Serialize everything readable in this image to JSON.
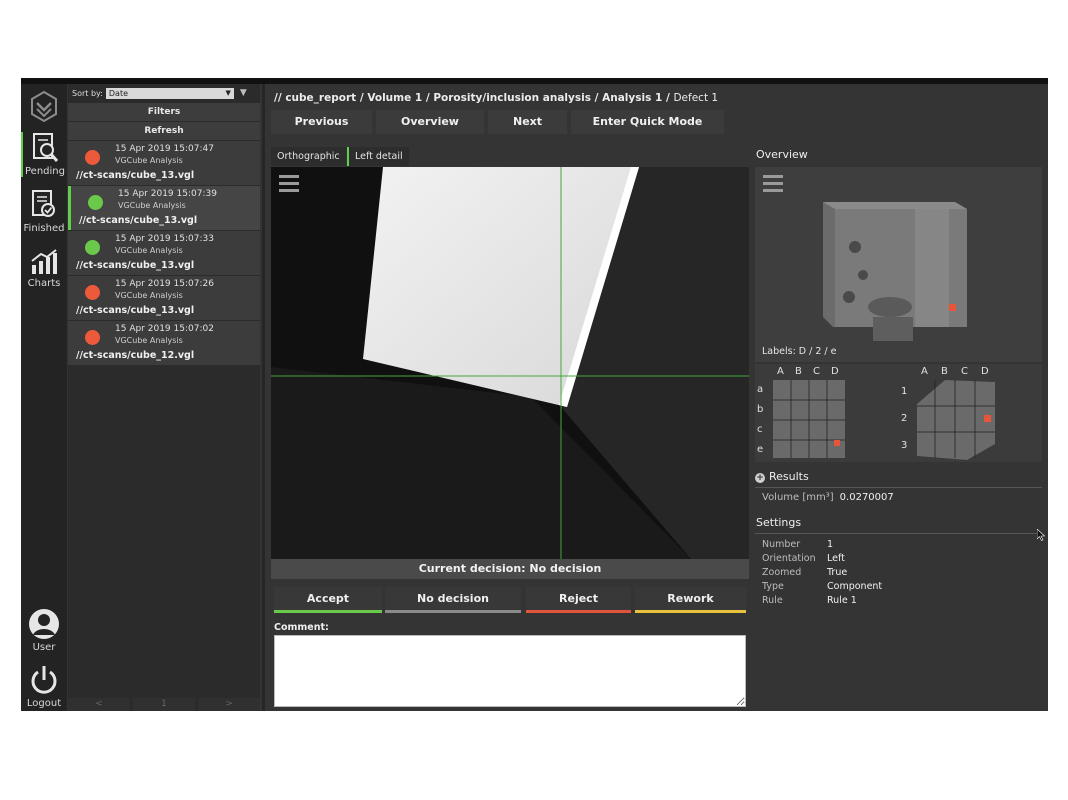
{
  "rail": {
    "pending": "Pending",
    "finished": "Finished",
    "charts": "Charts",
    "user": "User",
    "logout": "Logout"
  },
  "list": {
    "sort_label": "Sort by:",
    "sort_value": "Date",
    "filters": "Filters",
    "refresh": "Refresh",
    "jobs": [
      {
        "date": "15 Apr 2019 15:07:47",
        "kind": "VGCube Analysis",
        "path": "//ct-scans/cube_13.vgl",
        "status_color": "#ec5a3b"
      },
      {
        "date": "15 Apr 2019 15:07:39",
        "kind": "VGCube Analysis",
        "path": "//ct-scans/cube_13.vgl",
        "status_color": "#6ac94a"
      },
      {
        "date": "15 Apr 2019 15:07:33",
        "kind": "VGCube Analysis",
        "path": "//ct-scans/cube_13.vgl",
        "status_color": "#6ac94a"
      },
      {
        "date": "15 Apr 2019 15:07:26",
        "kind": "VGCube Analysis",
        "path": "//ct-scans/cube_13.vgl",
        "status_color": "#ec5a3b"
      },
      {
        "date": "15 Apr 2019 15:07:02",
        "kind": "VGCube Analysis",
        "path": "//ct-scans/cube_12.vgl",
        "status_color": "#ec5a3b"
      }
    ],
    "pager": {
      "prev": "<",
      "page": "1",
      "next": ">"
    }
  },
  "breadcrumb": {
    "prefix": "//",
    "items": [
      "cube_report",
      "Volume 1",
      "Porosity/inclusion analysis",
      "Analysis 1",
      "Defect 1"
    ],
    "sep": "/"
  },
  "nav": {
    "previous": "Previous",
    "overview": "Overview",
    "next": "Next",
    "quick": "Enter Quick Mode"
  },
  "view_tabs": [
    "Orthographic",
    "Left detail"
  ],
  "decision": {
    "current_label": "Current decision: No decision",
    "buttons": [
      {
        "label": "Accept",
        "color": "#6ac94a"
      },
      {
        "label": "No decision",
        "color": "#8a8a8a"
      },
      {
        "label": "Reject",
        "color": "#e2553a"
      },
      {
        "label": "Rework",
        "color": "#e8c23a"
      }
    ],
    "comment_label": "Comment:",
    "comment_value": ""
  },
  "overview": {
    "title": "Overview",
    "labels": "Labels: D / 2 / e",
    "cols": [
      "A",
      "B",
      "C",
      "D"
    ],
    "rows_left": [
      "a",
      "b",
      "c",
      "e"
    ],
    "rows_right": [
      "1",
      "2",
      "3"
    ]
  },
  "results": {
    "title": "Results",
    "volume_label": "Volume [mm³]",
    "volume_value": "0.0270007"
  },
  "settings": {
    "title": "Settings",
    "rows": [
      {
        "key": "Number",
        "value": "1"
      },
      {
        "key": "Orientation",
        "value": "Left"
      },
      {
        "key": "Zoomed",
        "value": "True"
      },
      {
        "key": "Type",
        "value": "Component"
      },
      {
        "key": "Rule",
        "value": "Rule 1"
      }
    ]
  },
  "colors": {
    "accent": "#5fcf4d",
    "defect": "#e8553a"
  }
}
